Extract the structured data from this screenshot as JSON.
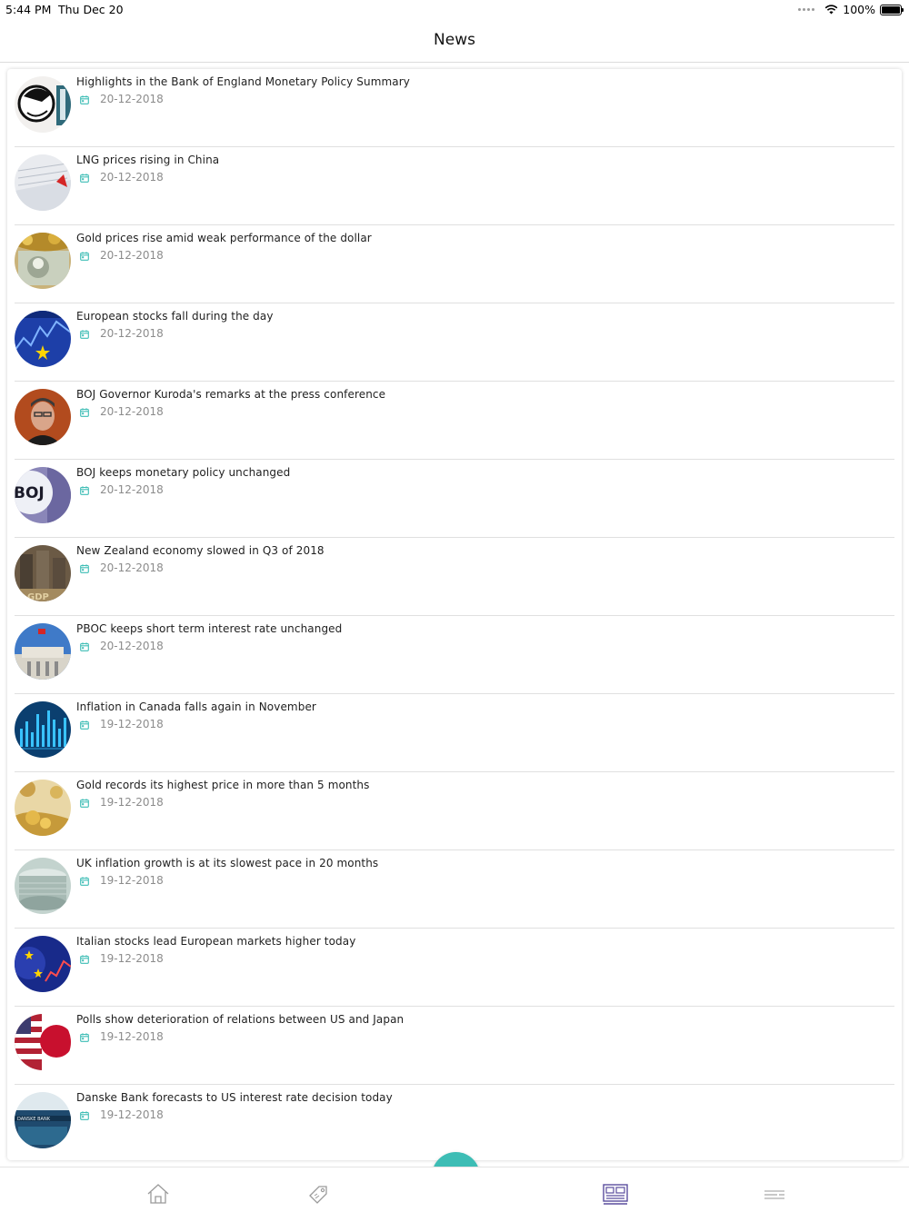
{
  "status": {
    "time": "5:44 PM",
    "date": "Thu Dec 20",
    "battery": "100%"
  },
  "header": {
    "title": "News"
  },
  "colors": {
    "accent": "#3dbdb5",
    "active_tab": "#5b4e9e",
    "inactive_tab": "#9a9a9a"
  },
  "news": [
    {
      "title": "Highlights in the Bank of England Monetary Policy Summary",
      "date": "20-12-2018",
      "thumb": "illustration"
    },
    {
      "title": "LNG prices rising in China",
      "date": "20-12-2018",
      "thumb": "paper-chart"
    },
    {
      "title": "Gold prices rise amid weak performance of the dollar",
      "date": "20-12-2018",
      "thumb": "gold-dollar"
    },
    {
      "title": "European stocks fall during the day",
      "date": "20-12-2018",
      "thumb": "eu-stocks"
    },
    {
      "title": "BOJ Governor Kuroda's remarks at the press conference",
      "date": "20-12-2018",
      "thumb": "portrait"
    },
    {
      "title": "BOJ keeps monetary policy unchanged",
      "date": "20-12-2018",
      "thumb": "boj-sign"
    },
    {
      "title": "New Zealand economy slowed in Q3 of 2018",
      "date": "20-12-2018",
      "thumb": "coins"
    },
    {
      "title": "PBOC keeps short term interest rate unchanged",
      "date": "20-12-2018",
      "thumb": "building"
    },
    {
      "title": "Inflation in Canada falls again in November",
      "date": "19-12-2018",
      "thumb": "blue-chart"
    },
    {
      "title": "Gold records its highest price in more than 5 months",
      "date": "19-12-2018",
      "thumb": "gold"
    },
    {
      "title": "UK inflation growth is at its slowest pace in 20 months",
      "date": "19-12-2018",
      "thumb": "coin-stack"
    },
    {
      "title": "Italian stocks lead European markets higher today",
      "date": "19-12-2018",
      "thumb": "euro-stocks"
    },
    {
      "title": "Polls show deterioration of relations between US and Japan",
      "date": "19-12-2018",
      "thumb": "us-japan"
    },
    {
      "title": "Danske Bank forecasts to US interest rate decision today",
      "date": "19-12-2018",
      "thumb": "bank-building"
    }
  ],
  "tabs": [
    {
      "icon": "home-icon"
    },
    {
      "icon": "tag-icon"
    },
    {
      "icon": "news-icon",
      "active": true
    },
    {
      "icon": "menu-icon"
    }
  ]
}
